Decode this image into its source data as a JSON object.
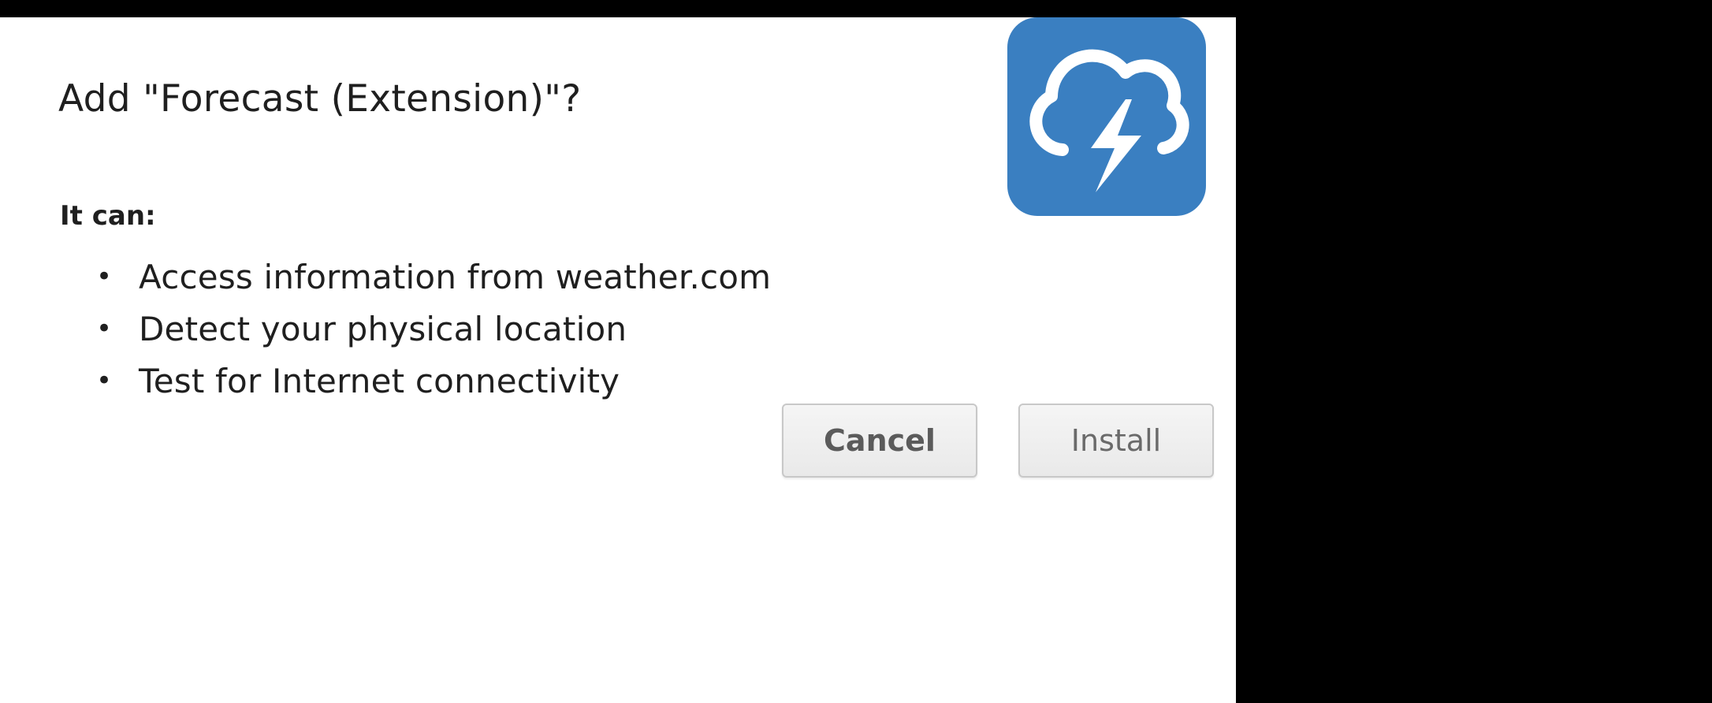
{
  "dialog": {
    "title": "Add \"Forecast (Extension)\"?",
    "icon": {
      "name": "cloud-lightning-icon",
      "background": "#3a7fc1"
    },
    "permissions_label": "It can:",
    "permissions": [
      "Access information from weather.com",
      "Detect your physical location",
      "Test for Internet connectivity"
    ],
    "bullet": "•",
    "buttons": {
      "cancel_label": "Cancel",
      "install_label": "Install"
    }
  }
}
